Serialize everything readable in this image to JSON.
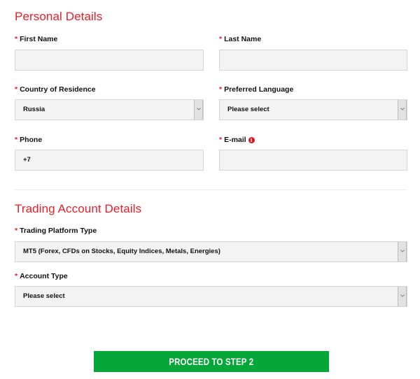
{
  "personal": {
    "title": "Personal Details",
    "first_name": {
      "label": "First Name",
      "value": ""
    },
    "last_name": {
      "label": "Last Name",
      "value": ""
    },
    "country": {
      "label": "Country of Residence",
      "value": "Russia"
    },
    "language": {
      "label": "Preferred Language",
      "value": "Please select"
    },
    "phone": {
      "label": "Phone",
      "value": "+7"
    },
    "email": {
      "label": "E-mail",
      "value": "",
      "info_icon": "info-icon"
    }
  },
  "trading": {
    "title": "Trading Account Details",
    "platform": {
      "label": "Trading Platform Type",
      "value": "MT5 (Forex, CFDs on Stocks, Equity Indices, Metals, Energies)"
    },
    "account_type": {
      "label": "Account Type",
      "value": "Please select"
    }
  },
  "required_marker": "*",
  "info_glyph": "i",
  "submit_label": "PROCEED TO STEP 2",
  "colors": {
    "accent": "#ee1c25",
    "button": "#05a838"
  }
}
